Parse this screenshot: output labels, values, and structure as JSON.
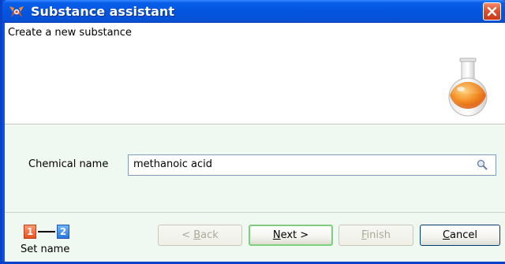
{
  "window": {
    "title": "Substance assistant",
    "close_icon": "close-icon"
  },
  "header": {
    "title": "Create a new substance",
    "illustration": "round-bottom-flask"
  },
  "form": {
    "chemical_name_label": "Chemical name",
    "chemical_name_value": "methanoic acid",
    "search_icon": "magnifier-icon"
  },
  "steps": {
    "step1": "1",
    "step2": "2",
    "current_caption": "Set name"
  },
  "buttons": {
    "back": {
      "prefix": "< ",
      "mnemonic": "B",
      "rest": "ack",
      "enabled": false
    },
    "next": {
      "mnemonic": "N",
      "rest": "ext >",
      "enabled": true,
      "default": true
    },
    "finish": {
      "mnemonic": "F",
      "rest": "inish",
      "enabled": false
    },
    "cancel": {
      "mnemonic": "C",
      "rest": "ancel",
      "enabled": true
    }
  },
  "colors": {
    "titlebar": "#0455e0",
    "pane_background": "#f0f9f1",
    "close_button": "#e0532e",
    "step_active": "#e8501f",
    "step_next": "#2a79d8"
  }
}
